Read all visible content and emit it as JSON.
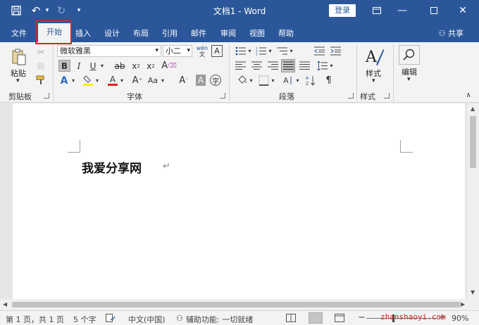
{
  "titlebar": {
    "title": "文档1 - Word",
    "login": "登录",
    "qa_icons": [
      "save-icon",
      "undo-icon",
      "redo-icon",
      "customize-icon"
    ],
    "win_icons": [
      "ribbon-display-icon",
      "minimize-icon",
      "maximize-icon",
      "close-icon"
    ]
  },
  "tabs": {
    "items": [
      "文件",
      "开始",
      "插入",
      "设计",
      "布局",
      "引用",
      "邮件",
      "审阅",
      "视图",
      "帮助"
    ],
    "active": "开始",
    "share": "共享"
  },
  "ribbon": {
    "clipboard": {
      "label": "剪贴板",
      "paste": "粘贴"
    },
    "font": {
      "label": "字体",
      "name": "微软雅黑",
      "size": "小二",
      "wen": "wén"
    },
    "paragraph": {
      "label": "段落"
    },
    "styles": {
      "label": "样式",
      "button": "样式"
    },
    "editing": {
      "button": "编辑"
    }
  },
  "document": {
    "text": "我爱分享网",
    "return_mark": "↵"
  },
  "status": {
    "page": "第 1 页，共 1 页",
    "words": "5 个字",
    "language": "中文(中国)",
    "accessibility": "辅助功能: 一切就绪",
    "zoom": "90%"
  },
  "watermark": "zhanshaoyi.com",
  "colors": {
    "accent": "#2b579a",
    "highlight_box": "#e02020"
  }
}
